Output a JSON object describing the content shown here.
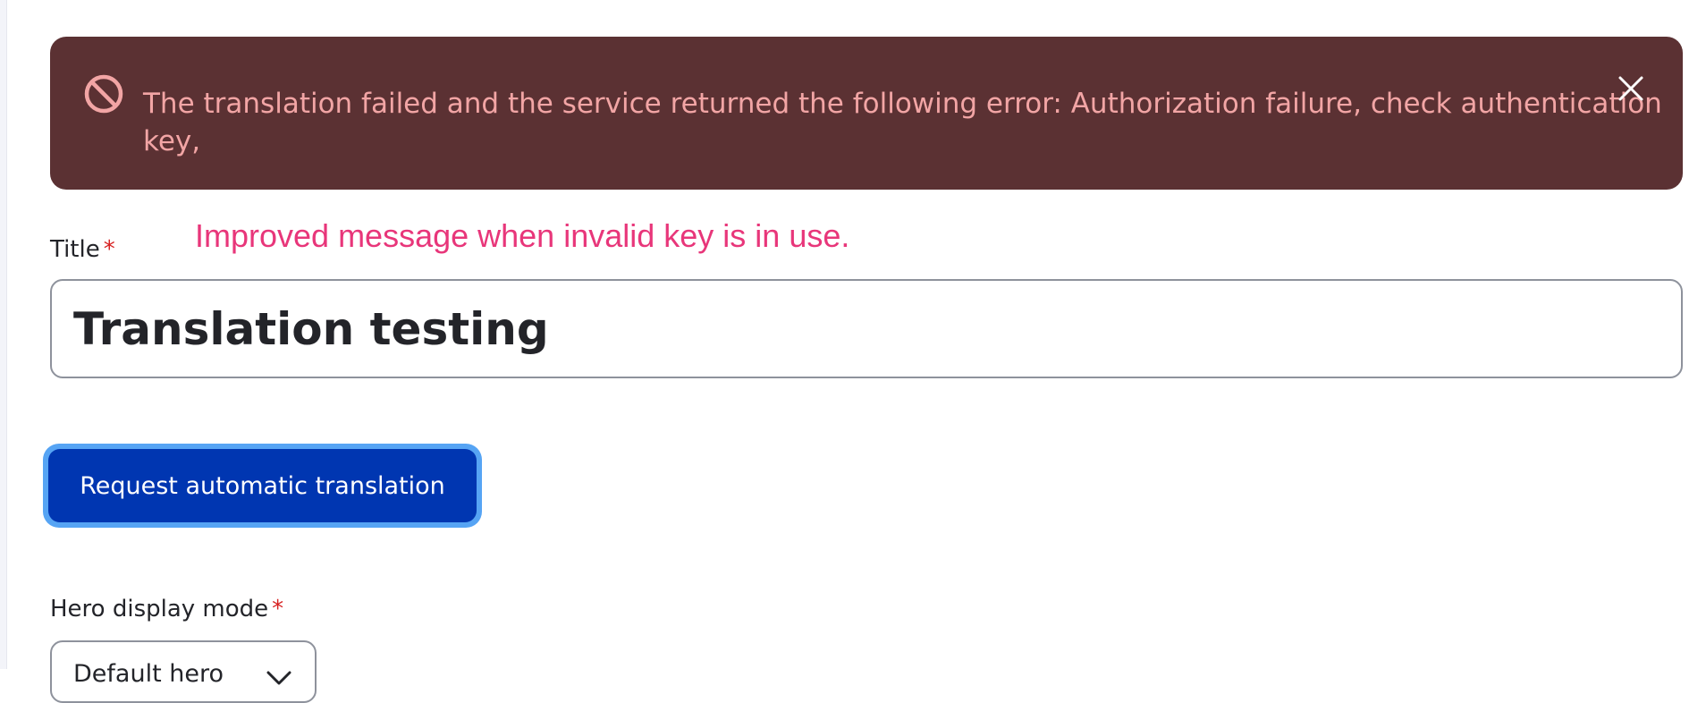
{
  "message": {
    "type": "error",
    "text": "The translation failed and the service returned the following error: Authorization failure, check authentication key,",
    "status_icon": "error-circle-slash-icon",
    "close_icon": "close-icon",
    "colors": {
      "background": "#5b3133",
      "text": "#f2a5a5"
    }
  },
  "annotation": {
    "text": "Improved message when invalid key is in use.",
    "color": "#e8367a"
  },
  "form": {
    "title_field": {
      "label": "Title",
      "required_mark": "*",
      "value": "Translation testing"
    },
    "request_button": {
      "label": "Request automatic translation",
      "colors": {
        "background": "#0036b1",
        "focus_ring": "#56a4f4"
      }
    },
    "hero_display_mode": {
      "label": "Hero display mode",
      "required_mark": "*",
      "selected": "Default hero"
    }
  }
}
